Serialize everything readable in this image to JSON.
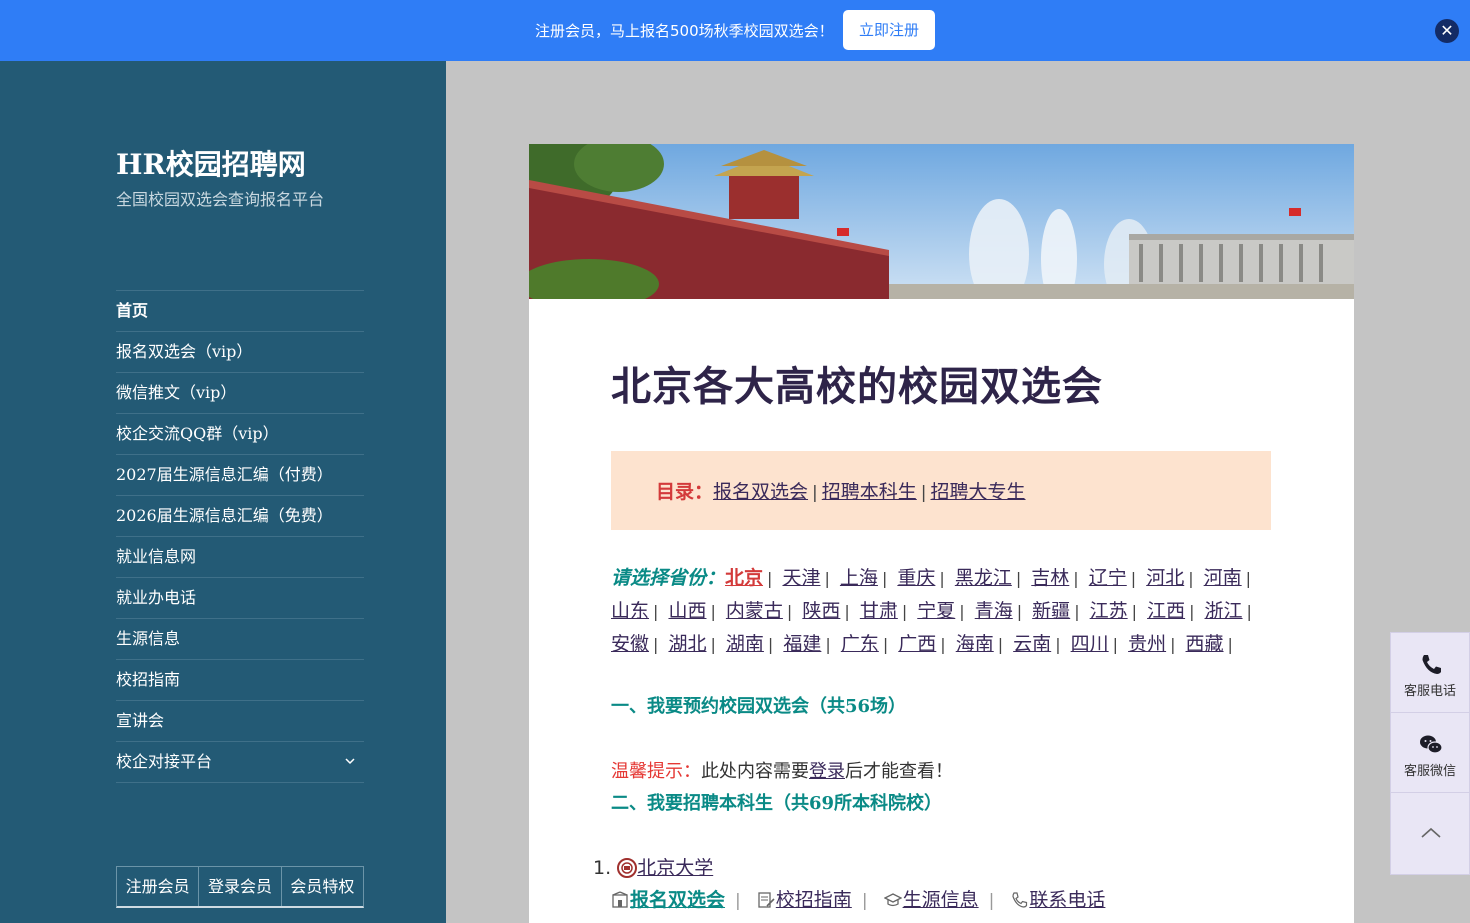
{
  "banner": {
    "text": "注册会员，马上报名500场秋季校园双选会！",
    "button_label": "立即注册",
    "close_glyph": "✕"
  },
  "site": {
    "title": "HR校园招聘网",
    "description": "全国校园双选会查询报名平台"
  },
  "nav": {
    "items": [
      {
        "label": "首页",
        "active": true
      },
      {
        "label": "报名双选会（vip）"
      },
      {
        "label": "微信推文（vip）"
      },
      {
        "label": "校企交流QQ群（vip）"
      },
      {
        "label": "2027届生源信息汇编（付费）"
      },
      {
        "label": "2026届生源信息汇编（免费）"
      },
      {
        "label": "就业信息网"
      },
      {
        "label": "就业办电话"
      },
      {
        "label": "生源信息"
      },
      {
        "label": "校招指南"
      },
      {
        "label": "宣讲会"
      },
      {
        "label": "校企对接平台",
        "has_submenu": true,
        "chevron_icon": "chevron-down-icon"
      }
    ]
  },
  "member_bar": {
    "register": "注册会员",
    "login": "登录会员",
    "privileges": "会员特权"
  },
  "article": {
    "title": "北京各大高校的校园双选会",
    "toc": {
      "label": "目录：",
      "links": [
        "报名双选会",
        "招聘本科生",
        "招聘大专生"
      ],
      "separator": "|"
    },
    "province_label": "请选择省份：",
    "provinces": [
      "北京",
      "天津",
      "上海",
      "重庆",
      "黑龙江",
      "吉林",
      "辽宁",
      "河北",
      "河南",
      "山东",
      "山西",
      "内蒙古",
      "陕西",
      "甘肃",
      "宁夏",
      "青海",
      "新疆",
      "江苏",
      "江西",
      "浙江",
      "安徽",
      "湖北",
      "湖南",
      "福建",
      "广东",
      "广西",
      "海南",
      "云南",
      "四川",
      "贵州",
      "西藏"
    ],
    "active_province": "北京",
    "section1": "一、我要预约校园双选会（共56场）",
    "tip_label": "温馨提示：",
    "tip_text_before": "此处内容需要",
    "tip_link": "登录",
    "tip_text_after": "后才能查看！",
    "section2": "二、我要招聘本科生（共69所本科院校）",
    "list_number": "1.",
    "university": "北京大学",
    "university_links": [
      "报名双选会",
      "校招指南",
      "生源信息",
      "联系电话"
    ]
  },
  "service": {
    "phone_label": "客服电话",
    "wechat_label": "客服微信"
  },
  "colors": {
    "banner": "#2f7df6",
    "sidebar": "#235a75",
    "accent_teal": "#0a8a86",
    "accent_red": "#d33a3a",
    "toc_bg": "#fde3cf"
  }
}
